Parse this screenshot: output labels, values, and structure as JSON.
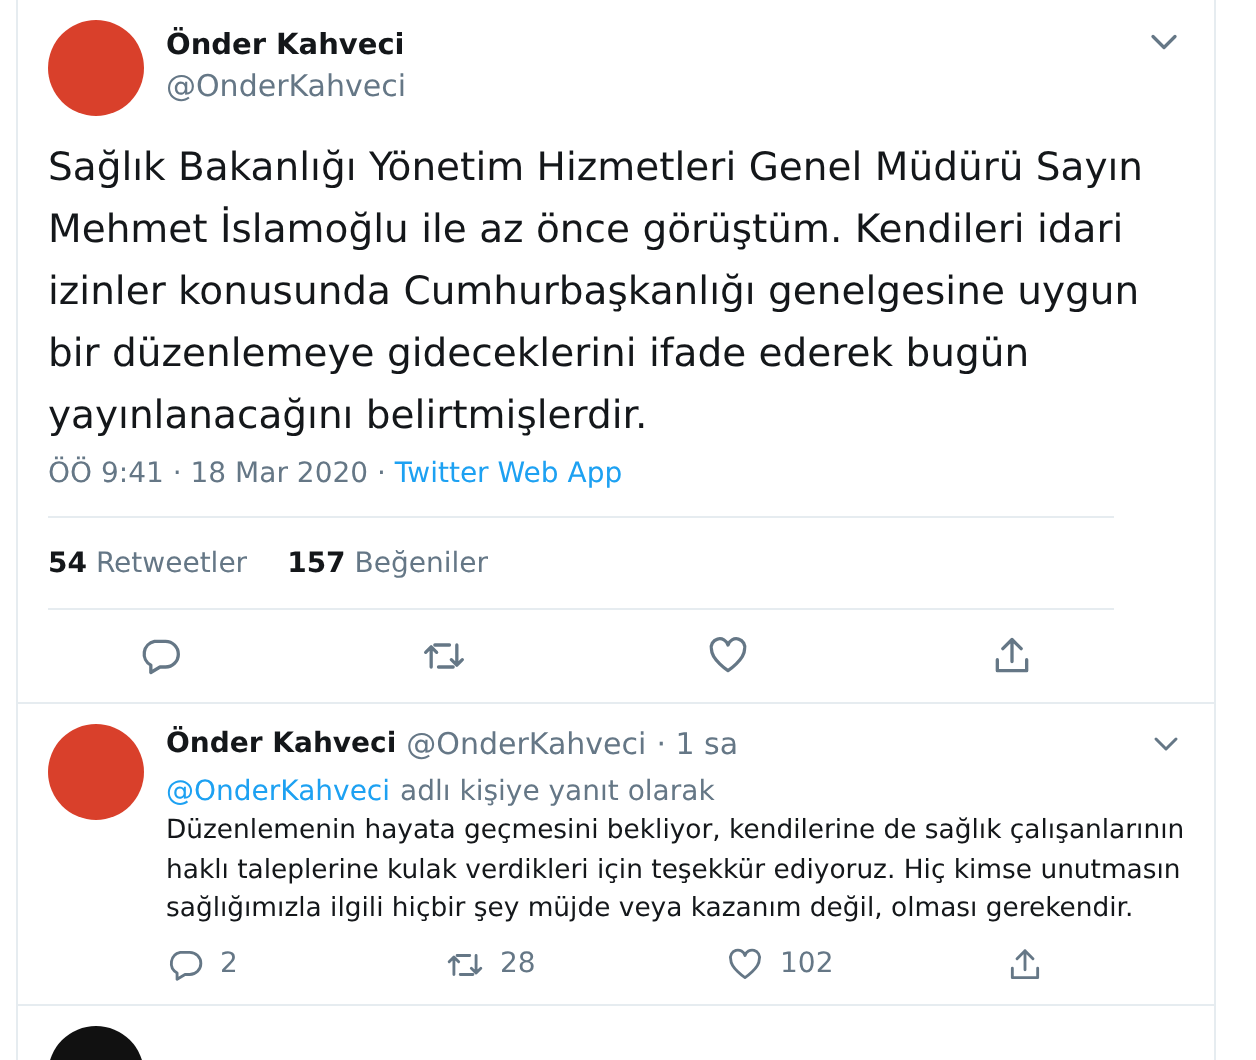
{
  "tweet": {
    "name": "Önder Kahveci",
    "handle": "@OnderKahveci",
    "text": "Sağlık Bakanlığı Yönetim Hizmetleri Genel Müdürü Sayın Mehmet İslamoğlu ile az önce görüştüm. Kendileri idari izinler konusunda Cumhurbaşkanlığı genelgesine uygun bir düzenlemeye gideceklerini ifade ederek bugün yayınlanacağını belirtmişlerdir.",
    "time": "ÖÖ 9:41 · 18 Mar 2020 · ",
    "source": "Twitter Web App",
    "stats": [
      {
        "count": "54",
        "label": "Retweetler"
      },
      {
        "count": "157",
        "label": "Beğeniler"
      }
    ]
  },
  "reply": {
    "name": "Önder Kahveci",
    "handle": "@OnderKahveci",
    "age": "· 1 sa",
    "reply_to_handle": "@OnderKahveci",
    "reply_to_text": "adlı kişiye yanıt olarak",
    "text": "Düzenlemenin hayata geçmesini bekliyor, kendilerine de sağlık çalışanlarının haklı taleplerine kulak verdikleri için teşekkür ediyoruz. Hiç kimse unutmasın sağlığımızla ilgili hiçbir şey müjde veya kazanım değil, olması gerekendir.",
    "actions": [
      {
        "kind": "reply",
        "count": "2"
      },
      {
        "kind": "retweet",
        "count": "28"
      },
      {
        "kind": "like",
        "count": "102"
      },
      {
        "kind": "share"
      }
    ]
  }
}
